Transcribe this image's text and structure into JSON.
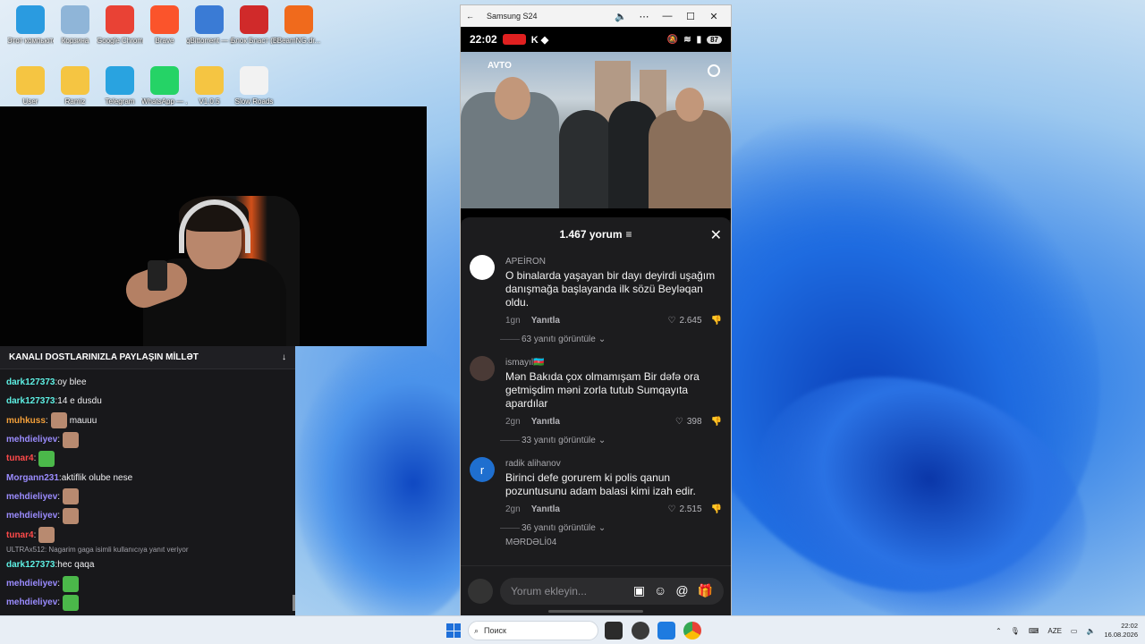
{
  "desktop": {
    "icons": [
      {
        "label": "Этот компьютер",
        "icon": "computer-icon",
        "color": "#2a9be0"
      },
      {
        "label": "Корзина",
        "icon": "recycle-bin-icon",
        "color": "#8fb5d8"
      },
      {
        "label": "Google Chrome",
        "icon": "chrome-icon",
        "color": "#e94235"
      },
      {
        "label": "Brave",
        "icon": "brave-icon",
        "color": "#fb542b"
      },
      {
        "label": "qBittorrent — ярлык",
        "icon": "qbittorrent-icon",
        "color": "#3a7bd5"
      },
      {
        "label": "Блок Бласт (Block Blast)",
        "icon": "block-blast-icon",
        "color": "#d02a2a"
      },
      {
        "label": "BeamNG.dr...",
        "icon": "beamng-icon",
        "color": "#f06a1c"
      },
      {
        "label": "User",
        "icon": "folder-icon",
        "color": "#f5c542"
      },
      {
        "label": "Ramiz",
        "icon": "folder-icon",
        "color": "#f5c542"
      },
      {
        "label": "Telegram",
        "icon": "telegram-icon",
        "color": "#29a3e0"
      },
      {
        "label": "WhatsApp — ...",
        "icon": "whatsapp-icon",
        "color": "#25d366"
      },
      {
        "label": "V1.0.5",
        "icon": "folder-icon",
        "color": "#f5c542"
      },
      {
        "label": "Slow Roads",
        "icon": "slow-roads-icon",
        "color": "#f2f2f2"
      }
    ]
  },
  "chat": {
    "header": "KANALI DOSTLARINIZLA PAYLAŞIN MİLLƏT",
    "messages": [
      {
        "user": "dark127373",
        "color": "#5ef0e4",
        "text": "oy blee",
        "emote": ""
      },
      {
        "user": "dark127373",
        "color": "#5ef0e4",
        "text": "14 e dusdu",
        "emote": ""
      },
      {
        "user": "muhkuss",
        "color": "#f4a03a",
        "text": "mauuu",
        "emote": "face"
      },
      {
        "user": "mehdieliyev",
        "color": "#9b8cff",
        "text": "",
        "emote": "face"
      },
      {
        "user": "tunar4",
        "color": "#ff4a4a",
        "text": "",
        "emote": "pepe"
      },
      {
        "user": "Morgann231",
        "color": "#9b8cff",
        "text": "aktiflik olube nese",
        "emote": ""
      },
      {
        "user": "mehdieliyev",
        "color": "#9b8cff",
        "text": "",
        "emote": "face"
      },
      {
        "user": "mehdieliyev",
        "color": "#9b8cff",
        "text": "",
        "emote": "face"
      },
      {
        "user": "tunar4",
        "color": "#ff4a4a",
        "text": "",
        "emote": "face"
      }
    ],
    "reply_note": "ULTRAx512: Nagarim gaga isimli kullanıcıya yanıt veriyor",
    "messages_after": [
      {
        "user": "dark127373",
        "color": "#5ef0e4",
        "text": "hec qaqa",
        "emote": ""
      },
      {
        "user": "mehdieliyev",
        "color": "#9b8cff",
        "text": "",
        "emote": "pepe"
      },
      {
        "user": "mehdieliyev",
        "color": "#9b8cff",
        "text": "",
        "emote": "pepe"
      }
    ]
  },
  "phone": {
    "window_title": "Samsung S24",
    "time": "22:02",
    "battery": "87",
    "video_logo": "AVTO",
    "comments_count": "1.467 yorum",
    "comments": [
      {
        "user": "APEİRON",
        "text": "O binalarda yaşayan bir dayı deyirdi uşağım danışmağa başlayanda ilk sözü Beyləqan oldu.",
        "age": "1gn",
        "reply": "Yanıtla",
        "likes": "2.645",
        "replies": "63 yanıtı görüntüle",
        "avatar_color": "#ffffff"
      },
      {
        "user": "ismayıl🇦🇿",
        "text": "Mən Bakıda çox olmamışam Bir dəfə ora getmişdim məni zorla tutub Sumqayıta apardılar",
        "age": "2gn",
        "reply": "Yanıtla",
        "likes": "398",
        "replies": "33 yanıtı görüntüle",
        "avatar_color": "#4a3a36"
      },
      {
        "user": "radik alihanov",
        "text": "Birinci defe gorurem ki polis qanun pozuntusunu adam balasi kimi izah edir.",
        "age": "2gn",
        "reply": "Yanıtla",
        "likes": "2.515",
        "replies": "36 yanıtı görüntüle",
        "avatar_color": "#1f6fcf",
        "avatar_letter": "r"
      }
    ],
    "next_user": "MƏRDƏLİ04",
    "comment_placeholder": "Yorum ekleyin..."
  },
  "taskbar": {
    "search_placeholder": "Поиск",
    "lang": "AZE",
    "time": "22:02",
    "date": "16.08.2026"
  }
}
